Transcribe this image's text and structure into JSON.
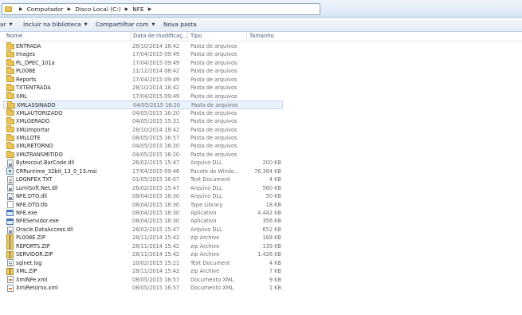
{
  "breadcrumb": [
    "Computador",
    "Disco Local (C:)",
    "NFE"
  ],
  "toolbar": {
    "buttons": [
      {
        "label": "ar",
        "has_menu": true
      },
      {
        "label": "Incluir na biblioteca",
        "has_menu": true
      },
      {
        "label": "Compartilhar com",
        "has_menu": true
      },
      {
        "label": "Nova pasta",
        "has_menu": false
      }
    ]
  },
  "columns": {
    "name": "Nome",
    "date": "Data de modificaç...",
    "type": "Tipo",
    "size": "Tamanho"
  },
  "files": [
    {
      "name": "ENTRADA",
      "date": "28/10/2014 18:42",
      "type": "Pasta de arquivos",
      "size": "",
      "icon": "folder-icon"
    },
    {
      "name": "Images",
      "date": "17/04/2015 09:49",
      "type": "Pasta de arquivos",
      "size": "",
      "icon": "folder-icon"
    },
    {
      "name": "PL_DPEC_101a",
      "date": "17/04/2015 09:49",
      "type": "Pasta de arquivos",
      "size": "",
      "icon": "folder-icon"
    },
    {
      "name": "PL008E",
      "date": "11/12/2014 08:42",
      "type": "Pasta de arquivos",
      "size": "",
      "icon": "folder-icon"
    },
    {
      "name": "Reports",
      "date": "17/04/2015 09:49",
      "type": "Pasta de arquivos",
      "size": "",
      "icon": "folder-icon"
    },
    {
      "name": "TXTENTRADA",
      "date": "28/10/2014 18:42",
      "type": "Pasta de arquivos",
      "size": "",
      "icon": "folder-icon"
    },
    {
      "name": "XML",
      "date": "17/04/2015 09:49",
      "type": "Pasta de arquivos",
      "size": "",
      "icon": "folder-icon"
    },
    {
      "name": "XMLASSINADO",
      "date": "04/05/2015 16:20",
      "type": "Pasta de arquivos",
      "size": "",
      "icon": "folder-icon",
      "selected": true
    },
    {
      "name": "XMLAUTORIZADO",
      "date": "04/05/2015 16:20",
      "type": "Pasta de arquivos",
      "size": "",
      "icon": "folder-icon"
    },
    {
      "name": "XMLGERADO",
      "date": "04/05/2015 15:31",
      "type": "Pasta de arquivos",
      "size": "",
      "icon": "folder-icon"
    },
    {
      "name": "XMLImportar",
      "date": "28/10/2014 18:42",
      "type": "Pasta de arquivos",
      "size": "",
      "icon": "folder-icon"
    },
    {
      "name": "XMLLOTE",
      "date": "08/05/2015 16:57",
      "type": "Pasta de arquivos",
      "size": "",
      "icon": "folder-icon"
    },
    {
      "name": "XMLRETORNO",
      "date": "04/05/2015 16:20",
      "type": "Pasta de arquivos",
      "size": "",
      "icon": "folder-icon"
    },
    {
      "name": "XMLTRANSMITIDO",
      "date": "04/05/2015 16:20",
      "type": "Pasta de arquivos",
      "size": "",
      "icon": "folder-icon"
    },
    {
      "name": "Bytescout.BarCode.dll",
      "date": "26/02/2015 15:47",
      "type": "Arquivo DLL",
      "size": "200 KB",
      "icon": "dll-icon"
    },
    {
      "name": "CRRuntime_32bit_13_0_13.msi",
      "date": "17/04/2015 09:46",
      "type": "Pacote do Windo...",
      "size": "76.384 KB",
      "icon": "msi-icon"
    },
    {
      "name": "LOGNFEX.TXT",
      "date": "01/05/2015 16:07",
      "type": "Text Document",
      "size": "4 KB",
      "icon": "text-file-icon"
    },
    {
      "name": "LumiSoft.Net.dll",
      "date": "26/02/2015 15:47",
      "type": "Arquivo DLL",
      "size": "560 KB",
      "icon": "dll-icon"
    },
    {
      "name": "NFE.DTO.dll",
      "date": "08/04/2015 18:30",
      "type": "Arquivo DLL",
      "size": "50 KB",
      "icon": "dll-icon"
    },
    {
      "name": "NFE.DTO.tlb",
      "date": "08/04/2015 18:30",
      "type": "Type Library",
      "size": "18 KB",
      "icon": "file-icon"
    },
    {
      "name": "NFE.exe",
      "date": "08/04/2015 18:30",
      "type": "Aplicativo",
      "size": "4.442 KB",
      "icon": "exe-icon"
    },
    {
      "name": "NFEServidor.exe",
      "date": "08/04/2015 18:30",
      "type": "Aplicativo",
      "size": "356 KB",
      "icon": "exe-icon"
    },
    {
      "name": "Oracle.DataAccess.dll",
      "date": "26/02/2015 15:47",
      "type": "Arquivo DLL",
      "size": "652 KB",
      "icon": "dll-icon"
    },
    {
      "name": "PL008E.ZIP",
      "date": "28/11/2014 15:42",
      "type": "zip Archive",
      "size": "168 KB",
      "icon": "zip-icon"
    },
    {
      "name": "REPORTS.ZIP",
      "date": "28/11/2014 15:42",
      "type": "zip Archive",
      "size": "139 KB",
      "icon": "zip-icon"
    },
    {
      "name": "SERVIDOR.ZIP",
      "date": "28/11/2014 15:42",
      "type": "zip Archive",
      "size": "1.426 KB",
      "icon": "zip-icon"
    },
    {
      "name": "sqlnet.log",
      "date": "10/02/2015 15:21",
      "type": "Text Document",
      "size": "4 KB",
      "icon": "text-file-icon"
    },
    {
      "name": "XML.ZIP",
      "date": "28/11/2014 15:42",
      "type": "zip Archive",
      "size": "7 KB",
      "icon": "zip-icon"
    },
    {
      "name": "XmlNFe.xml",
      "date": "08/05/2015 16:57",
      "type": "Documento XML",
      "size": "9 KB",
      "icon": "xml-file-icon"
    },
    {
      "name": "XmlRetorno.xml",
      "date": "08/05/2015 16:57",
      "type": "Documento XML",
      "size": "1 KB",
      "icon": "xml-file-icon"
    }
  ]
}
